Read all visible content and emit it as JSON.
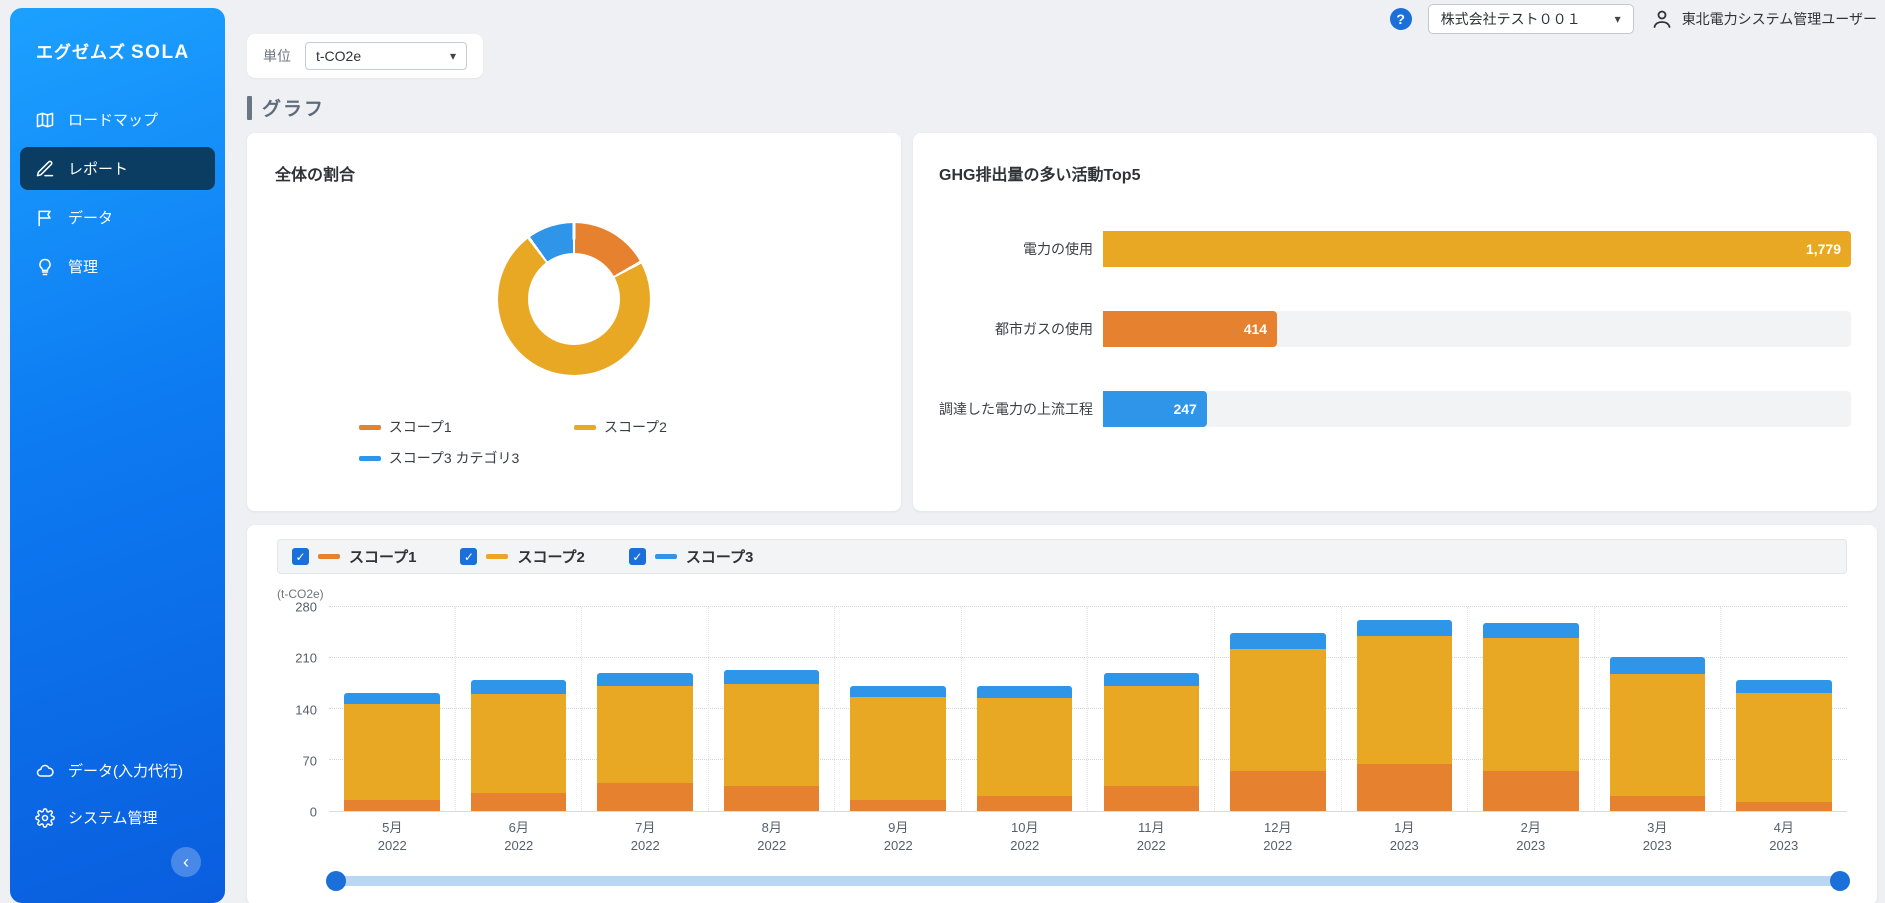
{
  "app": {
    "logo_text": "エグゼムズ",
    "logo_brand": "SOLA"
  },
  "icons": {
    "help": "?",
    "chevron_down": "▾",
    "collapse": "‹",
    "check": "✓"
  },
  "theme": {
    "scope1_orange": "#e6812f",
    "scope2_gold": "#e9a823",
    "scope3_blue": "#2e95e8",
    "brand_blue": "#1b6fd9",
    "sidebar_active": "#0b3c61"
  },
  "sidebar": {
    "items": [
      {
        "label": "ロードマップ",
        "icon": "map-icon",
        "active": false
      },
      {
        "label": "レポート",
        "icon": "pen-icon",
        "active": true
      },
      {
        "label": "データ",
        "icon": "flag-icon",
        "active": false
      },
      {
        "label": "管理",
        "icon": "bulb-icon",
        "active": false
      }
    ],
    "bottom_items": [
      {
        "label": "データ(入力代行)",
        "icon": "cloud-icon"
      },
      {
        "label": "システム管理",
        "icon": "gear-icon"
      }
    ]
  },
  "topbar": {
    "unit_label": "単位",
    "unit_value": "t-CO2e",
    "company_selector": "株式会社テスト００１",
    "user_name": "東北電力システム管理ユーザー"
  },
  "page": {
    "section_title": "グラフ"
  },
  "chart_data": [
    {
      "type": "pie",
      "donut": true,
      "title": "全体の割合",
      "labels": [
        "スコープ1",
        "スコープ2",
        "スコープ3 カテゴリ3"
      ],
      "values": [
        414,
        1779,
        247
      ],
      "colors": [
        "#e6812f",
        "#e9a823",
        "#2e95e8"
      ],
      "legend_position": "bottom"
    },
    {
      "type": "bar",
      "orientation": "horizontal",
      "title": "GHG排出量の多い活動Top5",
      "categories": [
        "電力の使用",
        "都市ガスの使用",
        "調達した電力の上流工程"
      ],
      "values": [
        1779,
        414,
        247
      ],
      "colors": [
        "#e9a823",
        "#e6812f",
        "#2e95e8"
      ],
      "xlim": [
        0,
        1779
      ]
    },
    {
      "type": "bar",
      "stacked": true,
      "title": "",
      "ylabel": "(t-CO2e)",
      "ylim": [
        0,
        280
      ],
      "yticks": [
        0,
        70,
        140,
        210,
        280
      ],
      "grid": true,
      "legend_position": "top",
      "categories": [
        "5月 2022",
        "6月 2022",
        "7月 2022",
        "8月 2022",
        "9月 2022",
        "10月 2022",
        "11月 2022",
        "12月 2022",
        "1月 2023",
        "2月 2023",
        "3月 2023",
        "4月 2023"
      ],
      "series": [
        {
          "name": "スコープ1",
          "color": "#e6812f",
          "checked": true,
          "values": [
            15,
            25,
            38,
            35,
            15,
            20,
            35,
            55,
            65,
            55,
            20,
            12
          ]
        },
        {
          "name": "スコープ2",
          "color": "#e9a823",
          "checked": true,
          "values": [
            132,
            135,
            134,
            140,
            142,
            135,
            137,
            168,
            175,
            182,
            168,
            150
          ]
        },
        {
          "name": "スコープ3",
          "color": "#2e95e8",
          "checked": true,
          "values": [
            15,
            20,
            18,
            18,
            15,
            17,
            18,
            22,
            22,
            21,
            24,
            18
          ]
        }
      ]
    }
  ]
}
